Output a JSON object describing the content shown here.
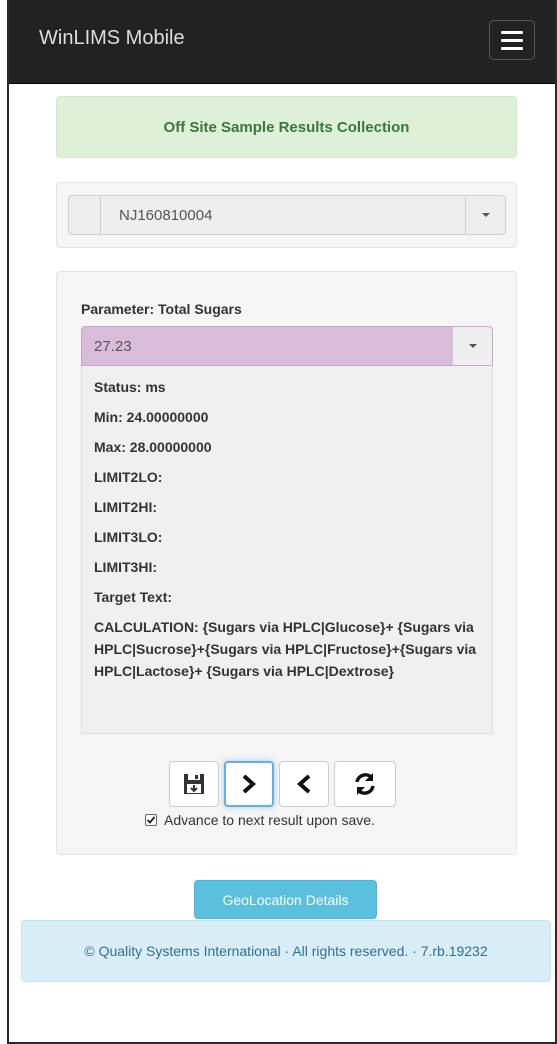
{
  "navbar": {
    "brand": "WinLIMS Mobile",
    "menu_icon": "hamburger-menu-icon"
  },
  "alert": {
    "text": "Off Site Sample Results Collection",
    "color": "#dff0d8"
  },
  "sample_select": {
    "value": "NJ160810004"
  },
  "result": {
    "parameter_label": "Parameter: Total Sugars",
    "value": "27.23",
    "value_bg_color": "#d9bcd9",
    "details": [
      "Status: ms",
      "Min: 24.00000000",
      "Max: 28.00000000",
      "LIMIT2LO:",
      "LIMIT2HI:",
      "LIMIT3LO:",
      "LIMIT3HI:",
      "Target Text:"
    ],
    "calculation": "CALCULATION: {Sugars via HPLC|Glucose}+ {Sugars via HPLC|Sucrose}+{Sugars via HPLC|Fructose}+{Sugars via HPLC|Lactose}+ {Sugars via HPLC|Dextrose}"
  },
  "toolbar": {
    "buttons": [
      {
        "icon": "save-icon"
      },
      {
        "icon": "chevron-right-icon"
      },
      {
        "icon": "chevron-left-icon"
      },
      {
        "icon": "refresh-icon"
      }
    ],
    "advance_label": "Advance to next result upon save.",
    "advance_checked": true
  },
  "geo_button": {
    "label": "GeoLocation Details",
    "color": "#5bc0de"
  },
  "footer": {
    "text": "© Quality Systems International · All rights reserved. · 7.rb.19232"
  }
}
